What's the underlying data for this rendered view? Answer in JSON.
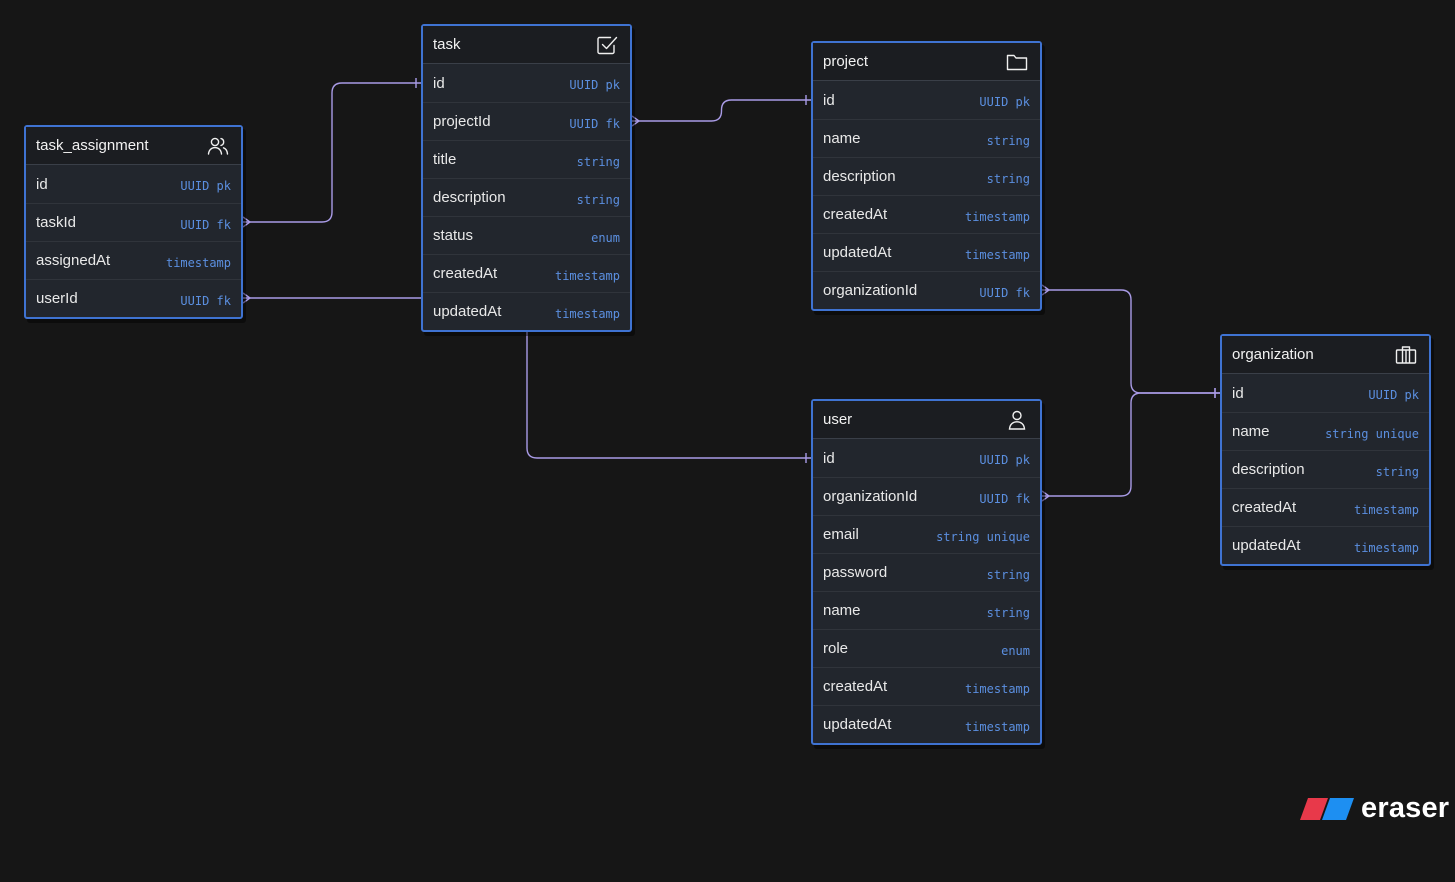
{
  "entities": {
    "task_assignment": {
      "title": "task_assignment",
      "icon": "users-icon",
      "fields": [
        {
          "name": "id",
          "type": "UUID pk"
        },
        {
          "name": "taskId",
          "type": "UUID fk"
        },
        {
          "name": "assignedAt",
          "type": "timestamp"
        },
        {
          "name": "userId",
          "type": "UUID fk"
        }
      ]
    },
    "task": {
      "title": "task",
      "icon": "checkbox-icon",
      "fields": [
        {
          "name": "id",
          "type": "UUID pk"
        },
        {
          "name": "projectId",
          "type": "UUID fk"
        },
        {
          "name": "title",
          "type": "string"
        },
        {
          "name": "description",
          "type": "string"
        },
        {
          "name": "status",
          "type": "enum"
        },
        {
          "name": "createdAt",
          "type": "timestamp"
        },
        {
          "name": "updatedAt",
          "type": "timestamp"
        }
      ]
    },
    "project": {
      "title": "project",
      "icon": "folder-icon",
      "fields": [
        {
          "name": "id",
          "type": "UUID pk"
        },
        {
          "name": "name",
          "type": "string"
        },
        {
          "name": "description",
          "type": "string"
        },
        {
          "name": "createdAt",
          "type": "timestamp"
        },
        {
          "name": "updatedAt",
          "type": "timestamp"
        },
        {
          "name": "organizationId",
          "type": "UUID fk"
        }
      ]
    },
    "user": {
      "title": "user",
      "icon": "user-icon",
      "fields": [
        {
          "name": "id",
          "type": "UUID pk"
        },
        {
          "name": "organizationId",
          "type": "UUID fk"
        },
        {
          "name": "email",
          "type": "string unique"
        },
        {
          "name": "password",
          "type": "string"
        },
        {
          "name": "name",
          "type": "string"
        },
        {
          "name": "role",
          "type": "enum"
        },
        {
          "name": "createdAt",
          "type": "timestamp"
        },
        {
          "name": "updatedAt",
          "type": "timestamp"
        }
      ]
    },
    "organization": {
      "title": "organization",
      "icon": "building-icon",
      "fields": [
        {
          "name": "id",
          "type": "UUID pk"
        },
        {
          "name": "name",
          "type": "string unique"
        },
        {
          "name": "description",
          "type": "string"
        },
        {
          "name": "createdAt",
          "type": "timestamp"
        },
        {
          "name": "updatedAt",
          "type": "timestamp"
        }
      ]
    }
  },
  "relations": [
    {
      "from": "task_assignment.taskId",
      "to": "task.id",
      "cardinality": "many-to-one"
    },
    {
      "from": "task_assignment.userId",
      "to": "user.id",
      "cardinality": "many-to-one"
    },
    {
      "from": "task.projectId",
      "to": "project.id",
      "cardinality": "many-to-one"
    },
    {
      "from": "project.organizationId",
      "to": "organization.id",
      "cardinality": "many-to-one"
    },
    {
      "from": "user.organizationId",
      "to": "organization.id",
      "cardinality": "many-to-one"
    }
  ],
  "brand": {
    "name": "eraser"
  },
  "colors": {
    "background": "#161616",
    "entity_border": "#3f73d2",
    "entity_fill": "#22262d",
    "type_text": "#5b8fe0",
    "connector": "#a99be6",
    "logo_red": "#e8394a",
    "logo_blue": "#1d8ff2"
  }
}
